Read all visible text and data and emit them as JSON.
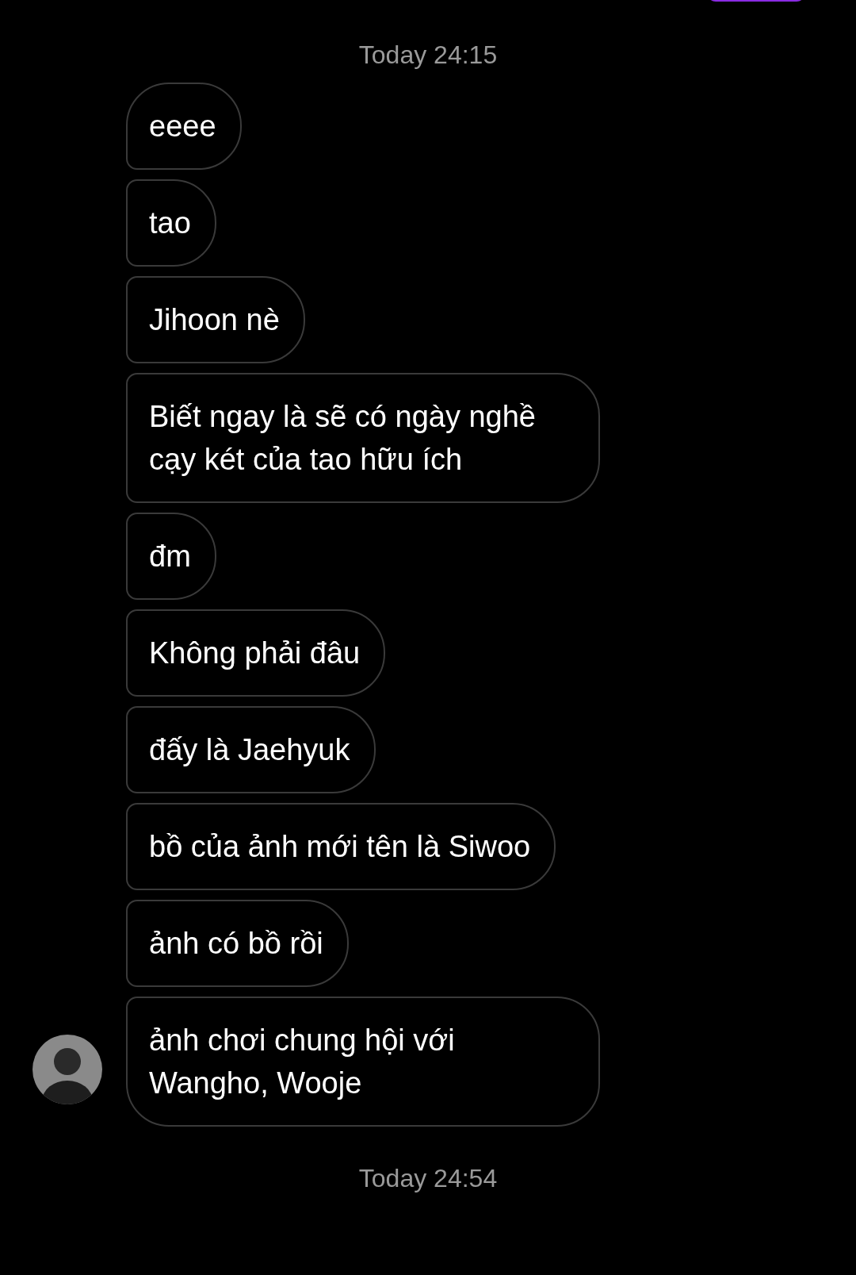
{
  "top_timestamp": "Today 24:15",
  "messages": [
    {
      "text": "eeee"
    },
    {
      "text": "tao"
    },
    {
      "text": "Jihoon nè"
    },
    {
      "text": "Biết ngay là sẽ có ngày nghề cạy két của tao hữu ích"
    },
    {
      "text": "đm"
    },
    {
      "text": "Không phải đâu"
    },
    {
      "text": "đấy là Jaehyuk"
    },
    {
      "text": "bồ của ảnh mới tên là Siwoo"
    },
    {
      "text": "ảnh có bồ rồi"
    },
    {
      "text": "ảnh chơi chung hội với Wangho, Wooje"
    }
  ],
  "bottom_timestamp": "Today 24:54"
}
